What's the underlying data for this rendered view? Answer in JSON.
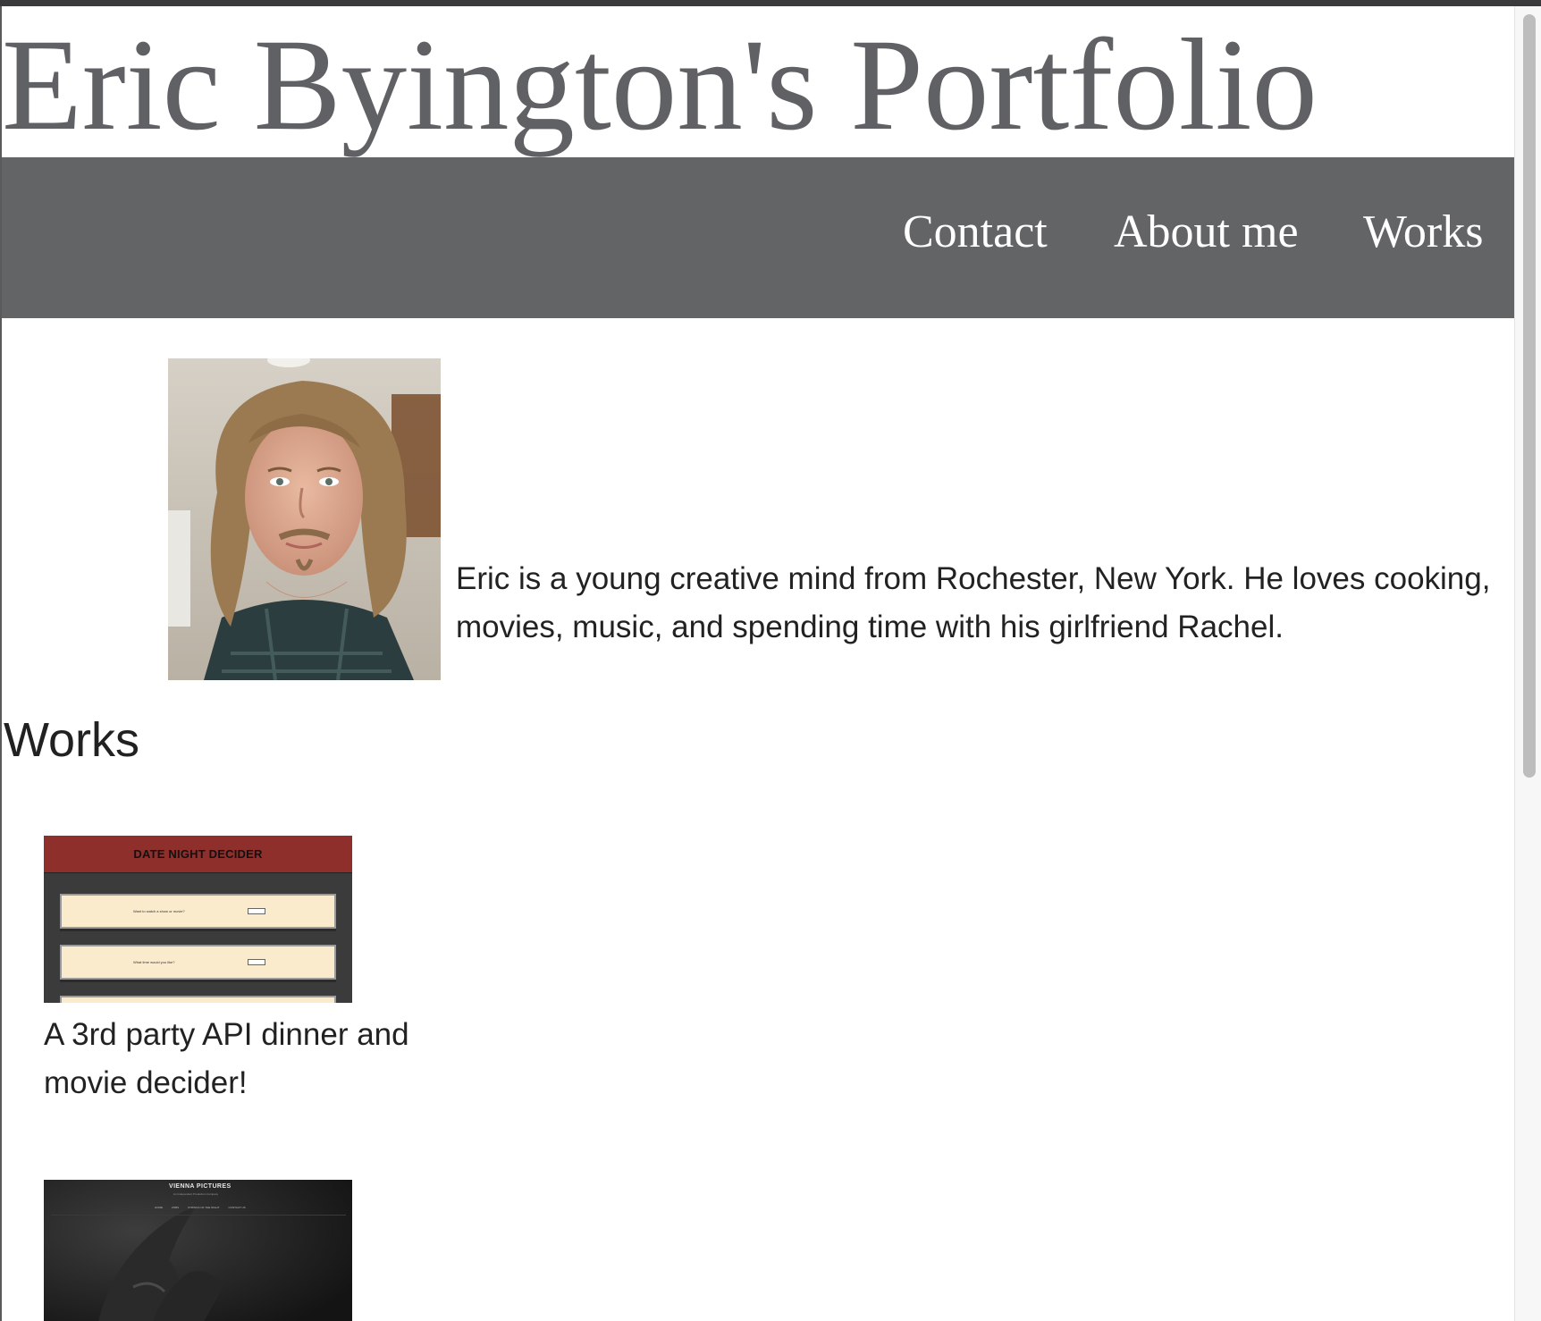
{
  "header": {
    "title": "Eric Byington's Portfolio"
  },
  "nav": {
    "items": [
      {
        "label": "Contact"
      },
      {
        "label": "About me"
      },
      {
        "label": "Works"
      }
    ]
  },
  "about": {
    "photo_alt": "Portrait of Eric",
    "text": "Eric is a young creative mind from Rochester, New York. He loves cooking, movies, music, and spending time with his girlfriend Rachel."
  },
  "works": {
    "heading": "Works",
    "items": [
      {
        "thumbnail": {
          "header": "DATE NIGHT DECIDER",
          "rows": [
            "Want to watch a show or movie?",
            "What time would you like?"
          ]
        },
        "description": "A 3rd party API dinner and movie decider!"
      },
      {
        "thumbnail": {
          "title": "VIENNA PICTURES",
          "subtitle": "An Independent Production Company",
          "nav": [
            "HOME",
            "ZOBS",
            "STRINGS OF THE NIGHT",
            "CONTACT US"
          ]
        }
      }
    ]
  },
  "colors": {
    "nav_bar": "#636466",
    "title_text": "#606164",
    "thumb_header": "#8e2f2b",
    "thumb_card": "#fbebcd"
  }
}
